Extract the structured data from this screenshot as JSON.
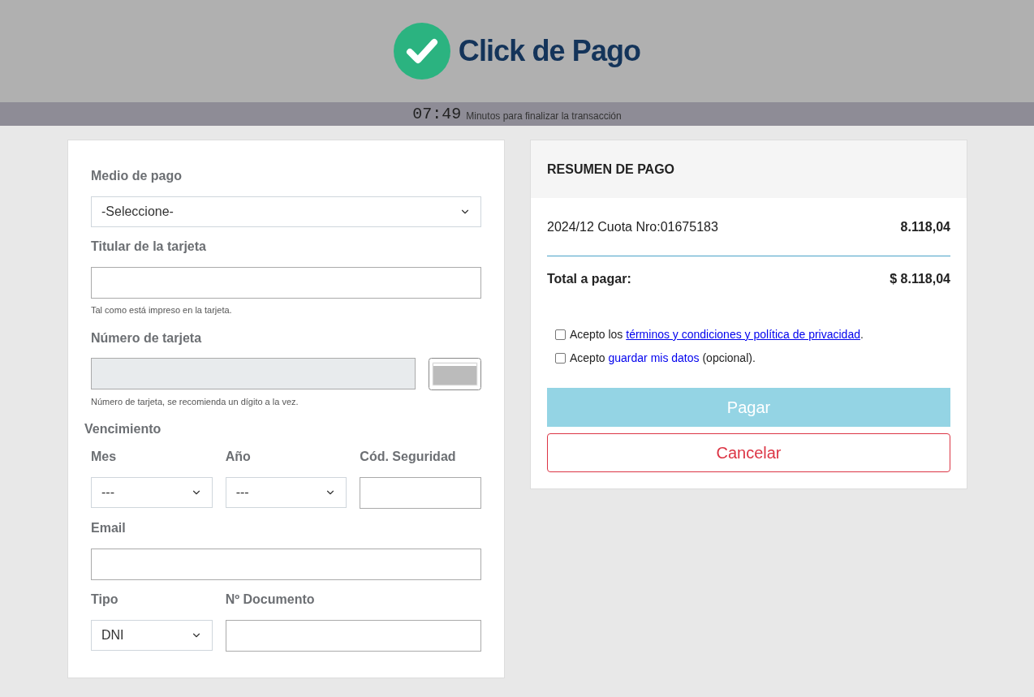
{
  "header": {
    "logo_text": "Click de Pago"
  },
  "timer": {
    "time": "07:49",
    "text": "Minutos para finalizar la transacción"
  },
  "form": {
    "payment_method": {
      "label": "Medio de pago",
      "value": "-Seleccione-"
    },
    "holder": {
      "label": "Titular de la tarjeta",
      "hint": "Tal como está impreso en la tarjeta."
    },
    "card_number": {
      "label": "Número de tarjeta",
      "disabled": true,
      "hint": "Número de tarjeta, se recomienda un dígito a la vez."
    },
    "expiry": {
      "label": "Vencimiento",
      "month": {
        "label": "Mes",
        "value": "---"
      },
      "year": {
        "label": "Año",
        "value": "---"
      }
    },
    "security_code": {
      "label": "Cód. Seguridad"
    },
    "email": {
      "label": "Email"
    },
    "doc_type": {
      "label": "Tipo",
      "value": "DNI"
    },
    "doc_number": {
      "label": "Nº Documento"
    }
  },
  "summary": {
    "title": "RESUMEN DE PAGO",
    "items": [
      {
        "description": "2024/12 Cuota Nro:01675183",
        "amount": "8.118,04"
      }
    ],
    "total": {
      "label": "Total a pagar:",
      "amount": "$ 8.118,04"
    },
    "consents": [
      {
        "before": "Acepto los ",
        "link": "términos y condiciones y política de privacidad",
        "after": ".",
        "underlined": true,
        "checked": false
      },
      {
        "before": "Acepto ",
        "link": "guardar mis datos",
        "after": " (opcional).",
        "underlined": false,
        "checked": false
      }
    ],
    "pay_button": {
      "label": "Pagar",
      "disabled": true
    },
    "cancel_button": {
      "label": "Cancelar"
    }
  }
}
